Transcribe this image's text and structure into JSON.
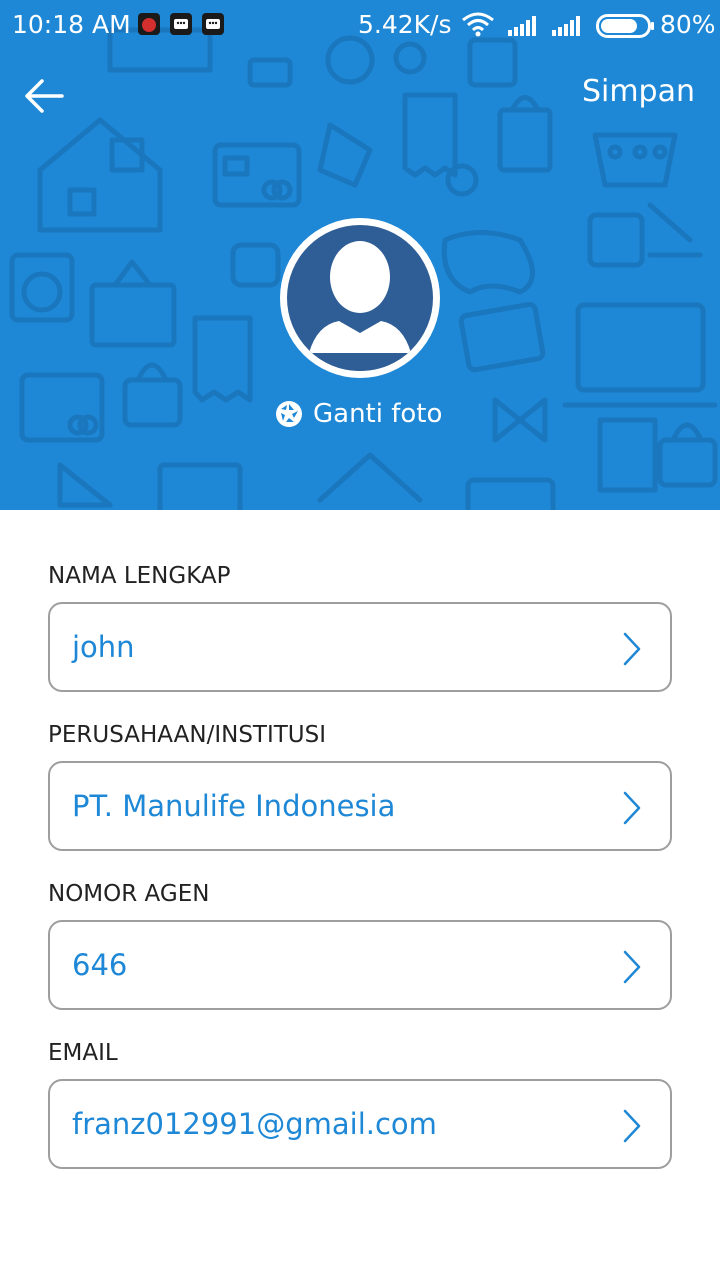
{
  "status_bar": {
    "time": "10:18  AM",
    "network_speed": "5.42K/s",
    "battery_percent": "80%",
    "battery_level": 0.8,
    "icons": [
      "notification-app-icon",
      "bbm-icon",
      "bbm-icon",
      "wifi-icon",
      "signal-icon",
      "signal-icon",
      "battery-icon"
    ]
  },
  "toolbar": {
    "back_icon": "arrow-left-icon",
    "save_label": "Simpan"
  },
  "profile": {
    "avatar_icon": "default-user-avatar",
    "change_photo_label": "Ganti foto",
    "change_photo_icon": "camera-aperture-icon"
  },
  "form": {
    "fields": [
      {
        "label": "NAMA LENGKAP",
        "value": "john"
      },
      {
        "label": "PERUSAHAAN/INSTITUSI",
        "value": "PT. Manulife Indonesia"
      },
      {
        "label": "NOMOR AGEN",
        "value": "646"
      },
      {
        "label": "EMAIL",
        "value": "franz012991@gmail.com"
      }
    ],
    "chevron_icon": "chevron-right-icon"
  },
  "colors": {
    "header_bg": "#1e88d6",
    "accent_text": "#1e88d6",
    "avatar_bg": "#2f5e96",
    "field_border": "#9e9e9e"
  }
}
